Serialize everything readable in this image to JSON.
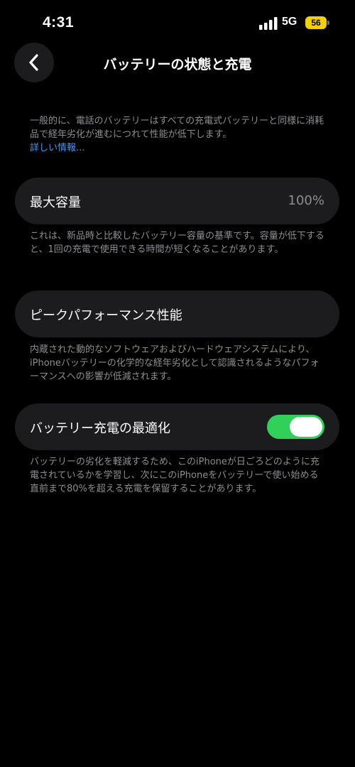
{
  "status_bar": {
    "time": "4:31",
    "network": "5G",
    "battery_level": "56",
    "battery_color": "#f5d000",
    "icons": [
      "signal-bars-icon",
      "battery-icon"
    ]
  },
  "nav": {
    "title": "バッテリーの状態と充電",
    "back_icon": "chevron-left-icon"
  },
  "intro": {
    "text": "一般的に、電話のバッテリーはすべての充電式バッテリーと同様に消耗品で経年劣化が進むにつれて性能が低下します。",
    "link": "詳しい情報..."
  },
  "max_capacity": {
    "label": "最大容量",
    "value": "100%",
    "description": "これは、新品時と比較したバッテリー容量の基準です。容量が低下すると、1回の充電で使用できる時間が短くなることがあります。"
  },
  "peak_performance": {
    "label": "ピークパフォーマンス性能",
    "description": "内蔵された動的なソフトウェアおよびハードウェアシステムにより、iPhoneバッテリーの化学的な経年劣化として認識されるようなパフォーマンスへの影響が低減されます。"
  },
  "optimized_charging": {
    "label": "バッテリー充電の最適化",
    "enabled": true,
    "toggle_color": "#30d158",
    "description": "バッテリーの劣化を軽減するため、このiPhoneが日ごろどのように充電されているかを学習し、次にこのiPhoneをバッテリーで使い始める直前まで80%を超える充電を保留することがあります。"
  }
}
